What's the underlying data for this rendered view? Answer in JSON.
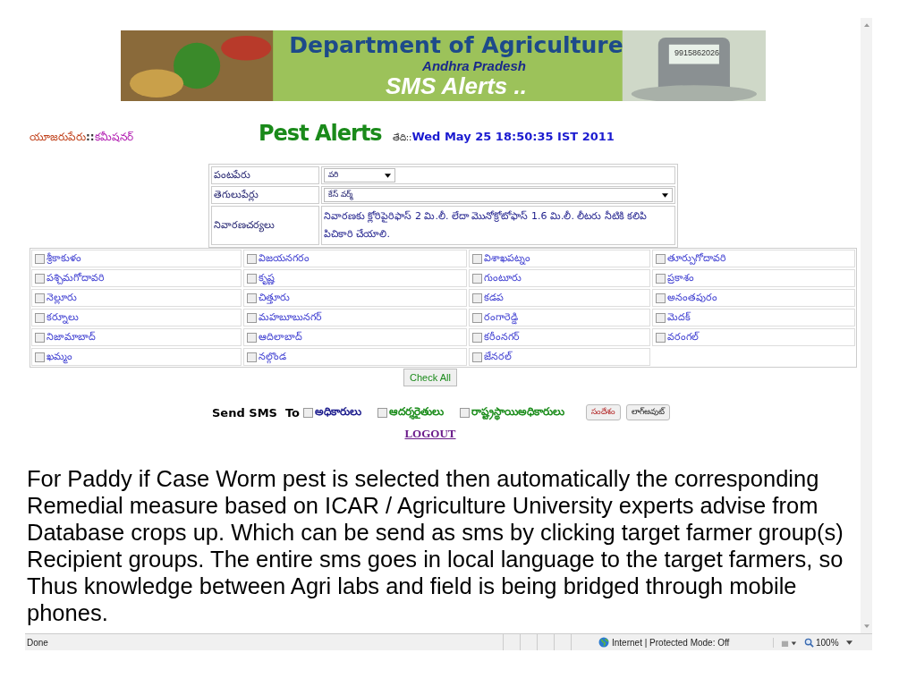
{
  "banner": {
    "title": "Department of Agriculture",
    "subtitle": "Andhra Pradesh",
    "tagline": "SMS Alerts ..",
    "phone_number": "9915862026"
  },
  "header": {
    "user_label": "యూజరుపేరు",
    "separator": "::",
    "user_name": "కమీషనర్",
    "title": "Pest Alerts",
    "date_label": "తేది::",
    "date": "Wed May 25 18:50:35 IST 2011"
  },
  "form": {
    "rows": [
      {
        "label": "పంటపేరు",
        "kind": "select_small",
        "value": "వరి"
      },
      {
        "label": "తెగులుపేర్లు",
        "kind": "select_wide",
        "value": "కేస్ వర్మ్"
      },
      {
        "label": "నివారణచర్యలు",
        "kind": "text",
        "value": "నివారణకు క్లోరిపైరిఫాస్ 2 మి.లీ. లేదా మొనోక్రోటోఫాస్ 1.6 మి.లీ. లీటరు నీటికి కలిపి పిచికారి చేయాలి."
      }
    ]
  },
  "districts": [
    {
      "name": "శ్రీకాకుళం",
      "checked": false
    },
    {
      "name": "విజయనగరం",
      "checked": false
    },
    {
      "name": "విశాఖపట్నం",
      "checked": false
    },
    {
      "name": "తూర్పుగోదావరి",
      "checked": false
    },
    {
      "name": "పశ్చిమగోదావరి",
      "checked": false
    },
    {
      "name": "కృష్ణ",
      "checked": false
    },
    {
      "name": "గుంటూరు",
      "checked": false
    },
    {
      "name": "ప్రకాశం",
      "checked": false
    },
    {
      "name": "నెల్లూరు",
      "checked": false
    },
    {
      "name": "చిత్తూరు",
      "checked": false
    },
    {
      "name": "కడప",
      "checked": false
    },
    {
      "name": "అనంతపురం",
      "checked": false
    },
    {
      "name": "కర్నూలు",
      "checked": false
    },
    {
      "name": "మహబూబునగర్",
      "checked": false
    },
    {
      "name": "రంగారెడ్డి",
      "checked": false
    },
    {
      "name": "మెదక్",
      "checked": false
    },
    {
      "name": "నిజామాబాద్",
      "checked": false
    },
    {
      "name": "ఆదిలాబాద్",
      "checked": false
    },
    {
      "name": "కరీంనగర్",
      "checked": false
    },
    {
      "name": "వరంగల్",
      "checked": false
    },
    {
      "name": "ఖమ్మం",
      "checked": false
    },
    {
      "name": "నల్గొండ",
      "checked": false
    },
    {
      "name": "జేనరల్",
      "checked": false
    }
  ],
  "check_all_button": "Check All",
  "send": {
    "label": "Send SMS  To",
    "recipients": [
      {
        "name": "అధికారులు",
        "checked": false,
        "color": "#1a1a8c"
      },
      {
        "name": "ఆదర్శరైతులు",
        "checked": false,
        "color": "#1a8c1a"
      },
      {
        "name": "రాష్ట్రస్థాయిఅధికారులు",
        "checked": false,
        "color": "#1a8c1a"
      }
    ],
    "buttons": [
      {
        "label": "సందేశం",
        "kind": "send"
      },
      {
        "label": "లాగ్అవుట్",
        "kind": "plain"
      }
    ]
  },
  "logout_link": "LOGOUT",
  "slide_text": "For Paddy if Case Worm pest is selected then automatically the corresponding Remedial measure based on ICAR / Agriculture University experts advise from Database crops up. Which can be send as sms by clicking target farmer group(s) Recipient groups. The entire sms goes in local language to the target farmers, so Thus knowledge between Agri labs and field is being bridged through mobile phones.",
  "status_bar": {
    "status": "Done",
    "zone": "Internet | Protected Mode: Off",
    "zoom": "100%"
  }
}
